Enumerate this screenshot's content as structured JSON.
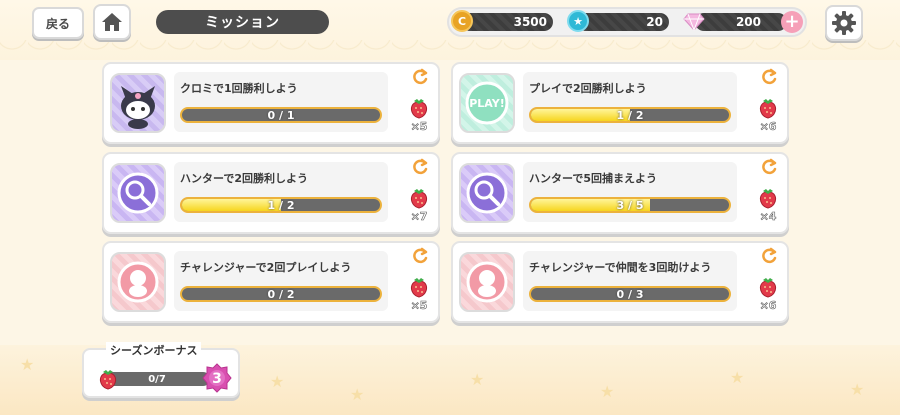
{
  "header": {
    "back_label": "戻る",
    "title": "ミッション",
    "coins": "3500",
    "stars": "20",
    "gems": "200"
  },
  "colors": {
    "accent_yellow": "#f6d51e",
    "bar_dark": "#6a6a6a",
    "bar_border": "#ecb23c",
    "refresh_orange": "#f2a23a"
  },
  "missions": [
    {
      "icon": "kuromi-icon",
      "text": "クロミで1回勝利しよう",
      "progress": "0 / 1",
      "fraction": 0,
      "reward": "×5"
    },
    {
      "icon": "play-icon",
      "text": "プレイで2回勝利しよう",
      "progress": "1 / 2",
      "fraction": 0.5,
      "reward": "×6"
    },
    {
      "icon": "hunter-icon",
      "text": "ハンターで2回勝利しよう",
      "progress": "1 / 2",
      "fraction": 0.5,
      "reward": "×7"
    },
    {
      "icon": "hunter-icon",
      "text": "ハンターで5回捕まえよう",
      "progress": "3 / 5",
      "fraction": 0.6,
      "reward": "×4"
    },
    {
      "icon": "challenger-icon",
      "text": "チャレンジャーで2回プレイしよう",
      "progress": "0 / 2",
      "fraction": 0,
      "reward": "×5"
    },
    {
      "icon": "challenger-icon",
      "text": "チャレンジャーで仲間を3回助けよう",
      "progress": "0 / 3",
      "fraction": 0,
      "reward": "×6"
    }
  ],
  "season_bonus": {
    "title": "シーズンボーナス",
    "progress": "0/7",
    "fraction": 0,
    "level": "3"
  }
}
